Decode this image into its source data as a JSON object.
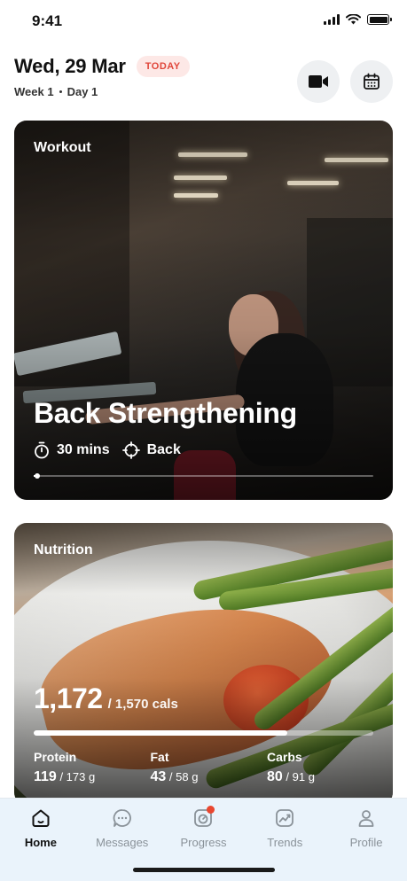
{
  "status_bar": {
    "time": "9:41"
  },
  "header": {
    "date": "Wed, 29 Mar",
    "today_badge": "TODAY",
    "week": "Week 1",
    "day": "Day 1"
  },
  "workout_card": {
    "label": "Workout",
    "title": "Back Strengthening",
    "duration": "30 mins",
    "focus": "Back",
    "progress": 0.01
  },
  "nutrition_card": {
    "label": "Nutrition",
    "calories": "1,172",
    "calories_target": "/ 1,570 cals",
    "calories_progress": 0.7465,
    "macros": [
      {
        "name": "Protein",
        "value": "119",
        "target": "/ 173 g"
      },
      {
        "name": "Fat",
        "value": "43",
        "target": "/ 58 g"
      },
      {
        "name": "Carbs",
        "value": "80",
        "target": "/ 91 g"
      }
    ]
  },
  "tab_bar": {
    "tabs": [
      {
        "label": "Home",
        "icon": "home-icon",
        "active": true
      },
      {
        "label": "Messages",
        "icon": "messages-icon",
        "active": false
      },
      {
        "label": "Progress",
        "icon": "progress-icon",
        "active": false,
        "badge": true
      },
      {
        "label": "Trends",
        "icon": "trends-icon",
        "active": false
      },
      {
        "label": "Profile",
        "icon": "profile-icon",
        "active": false
      }
    ]
  },
  "colors": {
    "accent": "#e0463a",
    "badge_bg": "#fde8e6",
    "tab_bar_bg": "#eaf3fb",
    "notification": "#e9462f"
  }
}
